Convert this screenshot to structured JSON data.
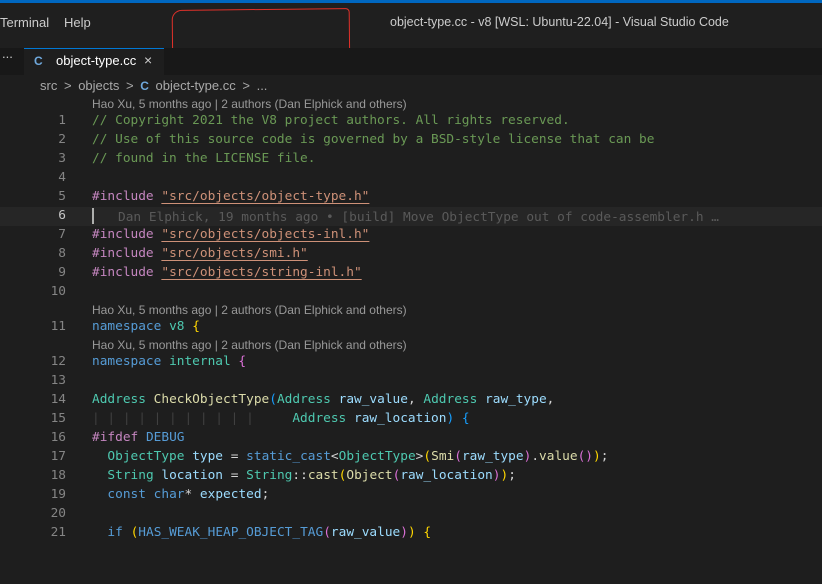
{
  "menu": {
    "terminal": "Terminal",
    "help": "Help"
  },
  "window_title": "object-type.cc - v8 [WSL: Ubuntu-22.04] - Visual Studio Code",
  "overflow_dots": "...",
  "tab": {
    "icon": "C",
    "name": "object-type.cc",
    "close": "×"
  },
  "breadcrumb": {
    "dir1": "src",
    "sep": ">",
    "dir2": "objects",
    "icon": "C",
    "file": "object-type.cc",
    "more": "..."
  },
  "codelens": [
    "Hao Xu, 5 months ago | 2 authors (Dan Elphick and others)",
    "Hao Xu, 5 months ago | 2 authors (Dan Elphick and others)",
    "Hao Xu, 5 months ago | 2 authors (Dan Elphick and others)"
  ],
  "blame_inline": "Dan Elphick, 19 months ago • [build] Move ObjectType out of code-assembler.h …",
  "lines": {
    "l1": "// Copyright 2021 the V8 project authors. All rights reserved.",
    "l2": "// Use of this source code is governed by a BSD-style license that can be",
    "l3": "// found in the LICENSE file.",
    "include": "#include",
    "inc1": "\"src/objects/object-type.h\"",
    "inc2": "\"src/objects/objects-inl.h\"",
    "inc3": "\"src/objects/smi.h\"",
    "inc4": "\"src/objects/string-inl.h\"",
    "namespace": "namespace",
    "ns1": "v8",
    "ns2": "internal",
    "ifdef": "#ifdef",
    "debug": "DEBUG",
    "address": "Address",
    "check_fn": "CheckObjectType",
    "raw_value": "raw_value",
    "raw_type": "raw_type",
    "raw_location": "raw_location",
    "object_type": "ObjectType",
    "type_var": "type",
    "static_cast": "static_cast",
    "smi": "Smi",
    "value_fn": "value",
    "string_ty": "String",
    "location_var": "location",
    "cast_fn": "cast",
    "object_ty": "Object",
    "const_kw": "const",
    "char_kw": "char",
    "expected_var": "expected",
    "if_kw": "if",
    "has_weak": "HAS_WEAK_HEAP_OBJECT_TAG"
  },
  "line_numbers": [
    "1",
    "2",
    "3",
    "4",
    "5",
    "6",
    "7",
    "8",
    "9",
    "10",
    "11",
    "12",
    "13",
    "14",
    "15",
    "16",
    "17",
    "18",
    "19",
    "20",
    "21"
  ]
}
